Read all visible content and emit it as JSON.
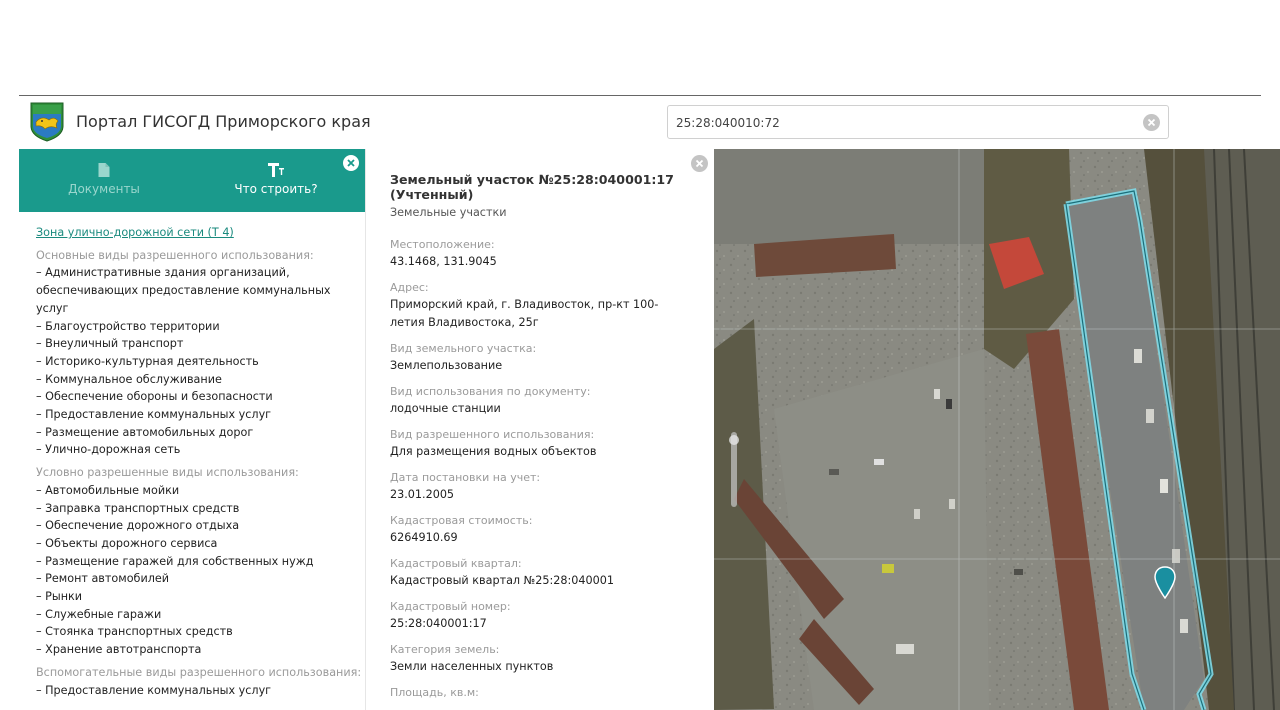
{
  "header": {
    "title": "Портал ГИСОГД Приморского края",
    "search_value": "25:28:040010:72"
  },
  "left_panel": {
    "tabs": [
      {
        "label": "Документы",
        "icon": "document-icon"
      },
      {
        "label": "Что строить?",
        "icon": "text-tool-icon"
      }
    ],
    "zone_link": "Зона улично-дорожной сети (Т 4)",
    "sections": [
      {
        "title": "Основные виды разрешенного использования:",
        "items": [
          "– Административные здания организаций, обеспечивающих предоставление коммунальных услуг",
          "– Благоустройство территории",
          "– Внеуличный транспорт",
          "– Историко-культурная деятельность",
          "– Коммунальное обслуживание",
          "– Обеспечение обороны и безопасности",
          "– Предоставление коммунальных услуг",
          "– Размещение автомобильных дорог",
          "– Улично-дорожная сеть"
        ]
      },
      {
        "title": "Условно разрешенные виды использования:",
        "items": [
          "– Автомобильные мойки",
          "– Заправка транспортных средств",
          "– Обеспечение дорожного отдыха",
          "– Объекты дорожного сервиса",
          "– Размещение гаражей для собственных нужд",
          "– Ремонт автомобилей",
          "– Рынки",
          "– Служебные гаражи",
          "– Стоянка транспортных средств",
          "– Хранение автотранспорта"
        ]
      },
      {
        "title": "Вспомогательные виды разрешенного использования:",
        "items": [
          "– Предоставление коммунальных услуг"
        ]
      }
    ]
  },
  "info_panel": {
    "title": "Земельный участок №25:28:040001:17 (Учтенный)",
    "subtitle": "Земельные участки",
    "fields": [
      {
        "label": "Местоположение:",
        "value": "43.1468, 131.9045"
      },
      {
        "label": "Адрес:",
        "value": "Приморский край, г. Владивосток, пр-кт 100-летия Владивостока, 25г"
      },
      {
        "label": "Вид земельного участка:",
        "value": "Землепользование"
      },
      {
        "label": "Вид использования по документу:",
        "value": "лодочные станции"
      },
      {
        "label": "Вид разрешенного использования:",
        "value": "Для размещения водных объектов"
      },
      {
        "label": "Дата постановки на учет:",
        "value": "23.01.2005"
      },
      {
        "label": "Кадастровая стоимость:",
        "value": "6264910.69"
      },
      {
        "label": "Кадастровый квартал:",
        "value": "Кадастровый квартал №25:28:040001"
      },
      {
        "label": "Кадастровый номер:",
        "value": "25:28:040001:17"
      },
      {
        "label": "Категория земель:",
        "value": "Земли населенных пунктов"
      },
      {
        "label": "Площадь, кв.м:",
        "value": ""
      }
    ]
  },
  "colors": {
    "accent": "#1a9a8c",
    "link": "#1a8a7e",
    "parcel_outline": "#7fd8e6",
    "marker": "#1a8fa0"
  }
}
